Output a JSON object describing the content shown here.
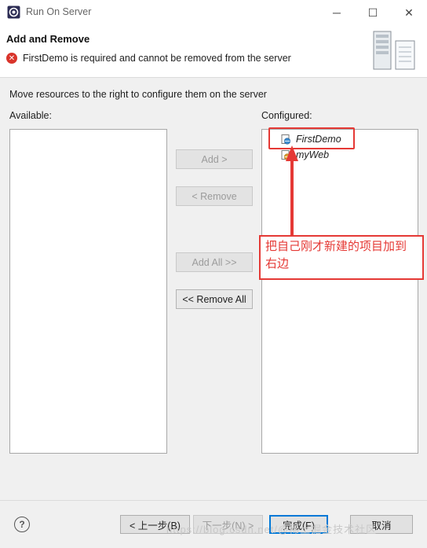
{
  "window": {
    "title": "Run On Server",
    "minimize": "─",
    "maximize": "☐",
    "close": "✕"
  },
  "header": {
    "title": "Add and Remove",
    "error_message": "FirstDemo is required and cannot be removed from the server"
  },
  "instructions": "Move resources to the right to configure them on the server",
  "available": {
    "label": "Available:",
    "items": []
  },
  "configured": {
    "label": "Configured:",
    "items": [
      {
        "label": "FirstDemo"
      },
      {
        "label": "myWeb"
      }
    ]
  },
  "buttons": {
    "add": "Add >",
    "remove": "< Remove",
    "add_all": "Add All >>",
    "remove_all": "<< Remove All"
  },
  "annotation": "把自己刚才新建的项目加到右边",
  "footer": {
    "help": "?",
    "back": "< 上一步(B)",
    "next": "下一步(N) >",
    "finish": "完成(F)",
    "cancel": "取消"
  },
  "watermark": "https://blog.csdn.net/@稀土掘金技术社区",
  "colors": {
    "annotation_red": "#e53935",
    "error_red": "#d9342b",
    "finish_border": "#0078d7"
  }
}
